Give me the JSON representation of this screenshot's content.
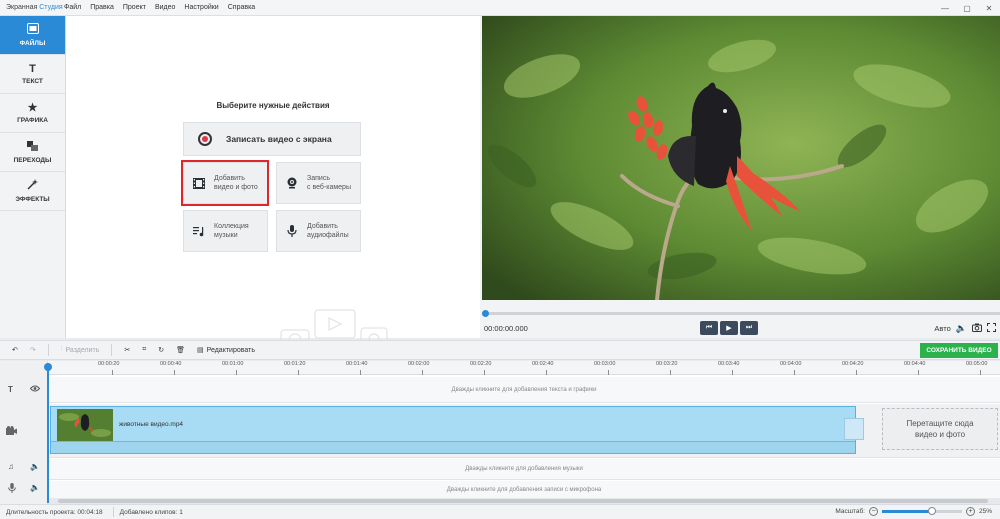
{
  "window": {
    "title_main": "Экранная ",
    "title_accent": "Студия",
    "menu": [
      "Файл",
      "Правка",
      "Проект",
      "Видео",
      "Настройки",
      "Справка"
    ],
    "controls": [
      "—",
      "▢",
      "✕"
    ]
  },
  "sidebar": {
    "items": [
      {
        "label": "ФАЙЛЫ",
        "icon": "files-icon",
        "active": true
      },
      {
        "label": "ТЕКСТ",
        "icon": "text-icon",
        "active": false
      },
      {
        "label": "ГРАФИКА",
        "icon": "graphics-icon",
        "active": false
      },
      {
        "label": "ПЕРЕХОДЫ",
        "icon": "transitions-icon",
        "active": false
      },
      {
        "label": "ЭФФЕКТЫ",
        "icon": "effects-icon",
        "active": false
      }
    ]
  },
  "actions": {
    "title": "Выберите нужные действия",
    "record_screen": "Записать видео с экрана",
    "add_video_line1": "Добавить",
    "add_video_line2": "видео и фото",
    "webcam_line1": "Запись",
    "webcam_line2": "с веб-камеры",
    "music_line1": "Коллекция",
    "music_line2": "музыки",
    "audio_line1": "Добавить",
    "audio_line2": "аудиофайлы"
  },
  "player": {
    "timecode": "00:00:00.000",
    "auto_label": "Авто",
    "progress": 0
  },
  "toolbar": {
    "split": "Разделить",
    "edit": "Редактировать",
    "save": "СОХРАНИТЬ ВИДЕО"
  },
  "timeline": {
    "ruler": [
      "00:00:20",
      "00:00:40",
      "00:01:00",
      "00:01:20",
      "00:01:40",
      "00:02:00",
      "00:02:20",
      "00:02:40",
      "00:03:00",
      "00:03:20",
      "00:03:40",
      "00:04:00",
      "00:04:20",
      "00:04:40",
      "00:05:00"
    ],
    "text_hint": "Дважды кликните для добавления текста и графики",
    "clip_name": "животные видео.mp4",
    "drop_line1": "Перетащите сюда",
    "drop_line2": "видео и фото",
    "music_hint": "Дважды кликните для добавления музыки",
    "mic_hint": "Дважды кликните для добавления записи с микрофона",
    "scroll_mark": "|||"
  },
  "status": {
    "duration": "Длительность проекта:  00:04:18",
    "clips": "Добавлено клипов: 1",
    "zoom_label": "Масштаб:",
    "zoom_value": "25%",
    "zoom_minus": "−",
    "zoom_plus": "+"
  },
  "colors": {
    "accent": "#2b8ad6",
    "save": "#2bb24c",
    "highlight": "#e0262b",
    "clip": "#a8dcf5"
  }
}
